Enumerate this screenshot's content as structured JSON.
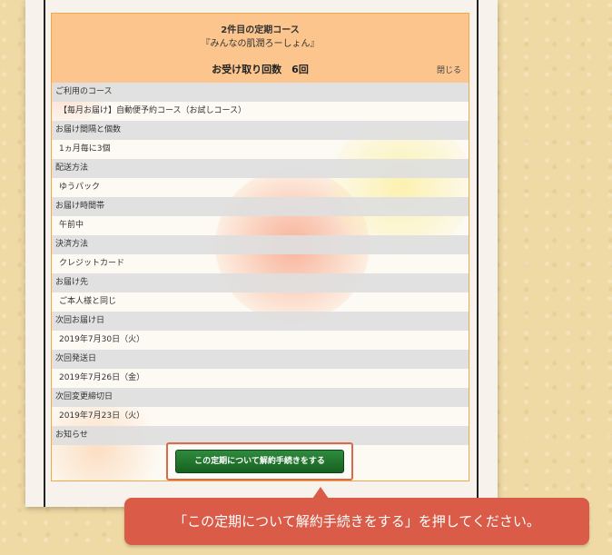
{
  "header": {
    "course_index": "2件目の定期コース",
    "course_name": "『みんなの肌潤ろーしょん』",
    "receive_count": "お受け取り回数　6回",
    "close_label": "閉じる"
  },
  "details": [
    {
      "label": "ご利用のコース",
      "value": "【毎月お届け】自動便予約コース（お試しコース）"
    },
    {
      "label": "お届け間隔と個数",
      "value": "1ヵ月毎に3個"
    },
    {
      "label": "配送方法",
      "value": "ゆうパック"
    },
    {
      "label": "お届け時間帯",
      "value": "午前中"
    },
    {
      "label": "決済方法",
      "value": "クレジットカード"
    },
    {
      "label": "お届け先",
      "value": "ご本人様と同じ"
    },
    {
      "label": "次回お届け日",
      "value": "2019年7月30日（火）"
    },
    {
      "label": "次回発送日",
      "value": "2019年7月26日（金）"
    },
    {
      "label": "次回変更締切日",
      "value": "2019年7月23日（火）"
    },
    {
      "label": "お知らせ",
      "value": ""
    }
  ],
  "cancel_button_label": "この定期について解約手続きをする",
  "callout_text": "「この定期について解約手続きをする」を押してください。",
  "colors": {
    "header_bg": "#fcc58e",
    "card_border": "#f0a848",
    "button_green": "#1f7a2e",
    "callout_red": "#d95b48",
    "background": "#efd9a4"
  }
}
